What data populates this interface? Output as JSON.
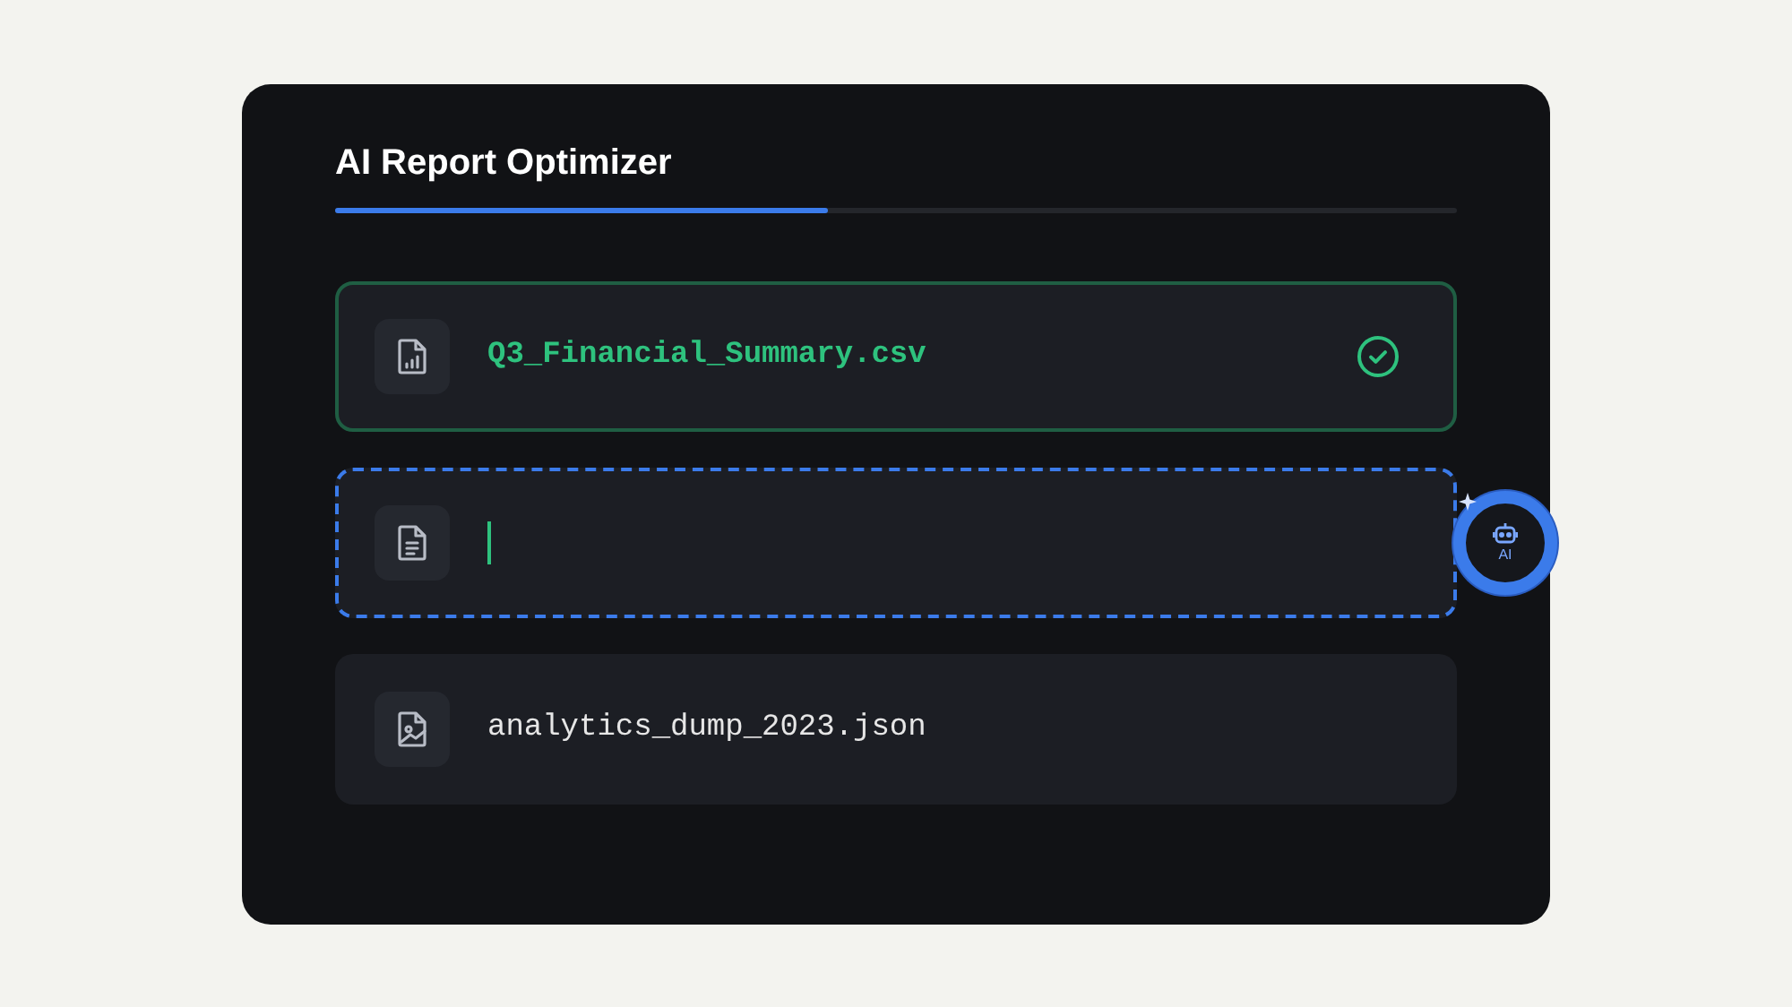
{
  "title": "AI Report Optimizer",
  "progress": {
    "level": 0.44
  },
  "files": [
    {
      "kind": "done",
      "name": "Q3_Financial_Summary.csv",
      "checked": true
    },
    {
      "kind": "active",
      "checked": false
    },
    {
      "kind": "pending",
      "name": "analytics_dump_2023.json",
      "checked": false
    }
  ],
  "assistant": {
    "label": "AI"
  }
}
